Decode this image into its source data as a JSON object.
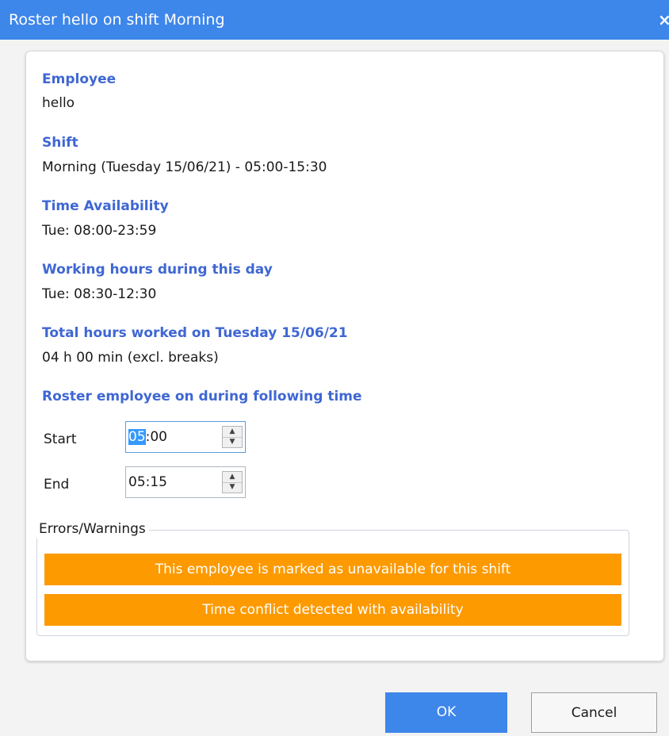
{
  "dialog": {
    "title": "Roster hello on shift Morning",
    "close_icon": "×"
  },
  "details": {
    "employee_label": "Employee",
    "employee_value": "hello",
    "shift_label": "Shift",
    "shift_value": "Morning (Tuesday 15/06/21) - 05:00-15:30",
    "availability_label": "Time Availability",
    "availability_value": "Tue: 08:00-23:59",
    "working_hours_label": "Working hours during this day",
    "working_hours_value": "Tue: 08:30-12:30",
    "total_hours_label": "Total hours worked on Tuesday 15/06/21",
    "total_hours_value": "04 h 00 min (excl. breaks)",
    "roster_label": "Roster employee on during following time"
  },
  "time_fields": {
    "start_label": "Start",
    "start_hours": "05",
    "start_rest": ":00",
    "end_label": "End",
    "end_value": "05:15",
    "spin_up_glyph": "▲",
    "spin_down_glyph": "▼"
  },
  "warnings": {
    "group_title": "Errors/Warnings",
    "items": [
      "This employee is marked as unavailable for this shift",
      "Time conflict detected with availability"
    ],
    "color": "#fd9a00"
  },
  "buttons": {
    "ok_label": "OK",
    "cancel_label": "Cancel"
  },
  "colors": {
    "accent": "#3d86ea",
    "label": "#3f67d3"
  }
}
